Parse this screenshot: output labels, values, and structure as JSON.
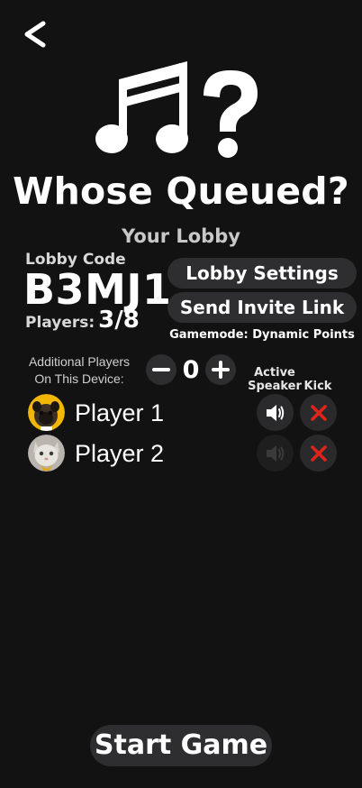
{
  "header": {
    "back_icon": "chevron-left-icon",
    "logo_icon": "music-notes-question-icon",
    "app_title": "Whose Queued?"
  },
  "lobby": {
    "section_title": "Your Lobby",
    "code_label": "Lobby Code",
    "code": "B3MJ1",
    "players_label": "Players:",
    "players_count": "3/8",
    "settings_label": "Lobby Settings",
    "invite_label": "Send Invite Link",
    "gamemode": "Gamemode: Dynamic Points"
  },
  "additional_players": {
    "label_line1": "Additional Players",
    "label_line2": "On This Device:",
    "value": "0",
    "decrement_icon": "minus-icon",
    "increment_icon": "plus-icon"
  },
  "columns": {
    "speaker_line1": "Active",
    "speaker_line2": "Speaker",
    "kick": "Kick"
  },
  "players": [
    {
      "name": "Player 1",
      "avatar": "pug-avatar",
      "active_speaker": true
    },
    {
      "name": "Player 2",
      "avatar": "cat-avatar",
      "active_speaker": false
    }
  ],
  "footer": {
    "start_label": "Start Game"
  },
  "colors": {
    "background": "#121213",
    "button": "#2e2e30",
    "kick_red": "#e2231a",
    "avatar_yellow": "#f2b705"
  }
}
